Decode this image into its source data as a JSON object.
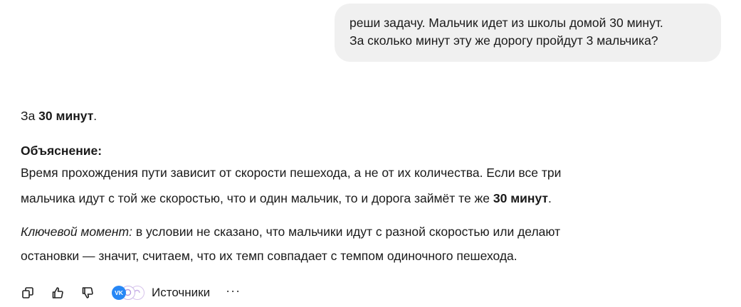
{
  "user_message": {
    "line1": "реши задачу. Мальчик идет из школы домой 30 минут.",
    "line2": "За сколько минут эту же дорогу пройдут 3 мальчика?"
  },
  "answer": {
    "intro_prefix": "За ",
    "intro_bold": "30 минут",
    "intro_suffix": ".",
    "explanation_heading": "Объяснение:",
    "explanation_line1": "Время прохождения пути зависит от скорости пешехода, а не от их количества. Если все три",
    "explanation_line2_prefix": "мальчика идут с той же скоростью, что и один мальчик, то и дорога займёт те же ",
    "explanation_line2_bold": "30 минут",
    "explanation_line2_suffix": ".",
    "key_label": "Ключевой момент:",
    "key_line1_rest": " в условии не сказано, что мальчики идут с разной скоростью или делают",
    "key_line2": "остановки — значит, считаем, что их темп совпадает с темпом одиночного пешехода."
  },
  "toolbar": {
    "copy_icon": "copy-icon",
    "like_icon": "thumbs-up-icon",
    "dislike_icon": "thumbs-down-icon",
    "sources_badge_text": "VK",
    "sources_label": "Источники",
    "more_label": "···"
  }
}
